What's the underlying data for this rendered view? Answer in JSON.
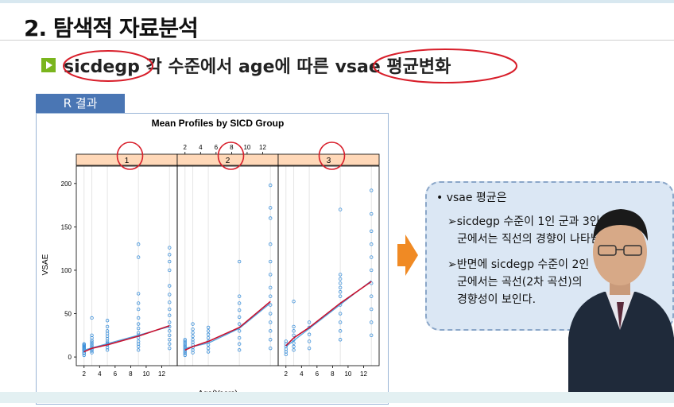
{
  "slide": {
    "title": "2. 탐색적 자료분석",
    "subtitle": "sicdegp 각 수준에서 age에 따른 vsae 평균변화",
    "tab_label": "R 결과"
  },
  "note": {
    "heading": "• vsae 평균은",
    "point1_line1": "➢sicdegp 수준이  1인 군과 3인",
    "point1_line2": "군에서는 직선의 경향이 나타남",
    "point2_line1": "➢반면에 sicdegp 수준이 2인",
    "point2_line2": "군에서는 곡선(2차 곡선)의",
    "point2_line3": "경향성이 보인다."
  },
  "chart_data": {
    "type": "scatter",
    "title": "Mean Profiles by SICD Group",
    "xlabel": "Age(Years)",
    "ylabel": "VSAE",
    "x_ticks": [
      2,
      4,
      6,
      8,
      10,
      12
    ],
    "y_ticks": [
      0,
      50,
      100,
      150,
      200
    ],
    "xlim": [
      1,
      14
    ],
    "ylim": [
      -10,
      220
    ],
    "panels": [
      {
        "name": "1",
        "points": {
          "2": [
            2,
            4,
            5,
            7,
            8,
            9,
            10,
            11,
            12,
            13,
            14,
            15
          ],
          "3": [
            5,
            7,
            9,
            11,
            13,
            15,
            17,
            19,
            22,
            25,
            45
          ],
          "5": [
            8,
            11,
            14,
            16,
            18,
            21,
            24,
            27,
            30,
            35,
            42
          ],
          "9": [
            8,
            12,
            15,
            18,
            22,
            25,
            28,
            33,
            38,
            45,
            55,
            62,
            73,
            115,
            130
          ],
          "13": [
            10,
            15,
            20,
            25,
            30,
            35,
            40,
            48,
            55,
            63,
            72,
            82,
            100,
            110,
            118,
            126
          ]
        },
        "mean_line": [
          [
            2,
            6
          ],
          [
            3,
            10
          ],
          [
            5,
            14
          ],
          [
            9,
            24
          ],
          [
            13,
            36
          ]
        ],
        "fit_line": [
          [
            2,
            8
          ],
          [
            13,
            35
          ]
        ]
      },
      {
        "name": "2",
        "points": {
          "2": [
            2,
            4,
            6,
            8,
            10,
            12,
            14,
            16,
            18,
            20
          ],
          "3": [
            5,
            8,
            11,
            14,
            17,
            20,
            24,
            28,
            32,
            38
          ],
          "5": [
            6,
            10,
            14,
            18,
            22,
            26,
            30,
            34
          ],
          "9": [
            8,
            15,
            22,
            30,
            38,
            46,
            54,
            62,
            70,
            110
          ],
          "13": [
            10,
            20,
            30,
            40,
            50,
            60,
            70,
            80,
            95,
            110,
            130,
            160,
            172,
            198
          ]
        },
        "mean_line": [
          [
            2,
            8
          ],
          [
            3,
            12
          ],
          [
            5,
            18
          ],
          [
            9,
            34
          ],
          [
            13,
            64
          ]
        ],
        "fit_line": [
          [
            2,
            10
          ],
          [
            5,
            16
          ],
          [
            9,
            33
          ],
          [
            13,
            62
          ]
        ]
      },
      {
        "name": "3",
        "points": {
          "2": [
            3,
            6,
            9,
            12,
            15,
            18
          ],
          "3": [
            8,
            12,
            16,
            20,
            25,
            30,
            35,
            64
          ],
          "5": [
            10,
            18,
            26,
            34,
            40
          ],
          "9": [
            20,
            30,
            40,
            50,
            60,
            70,
            75,
            80,
            85,
            90,
            95,
            170
          ],
          "13": [
            25,
            40,
            55,
            70,
            85,
            100,
            115,
            130,
            145,
            165,
            192
          ]
        },
        "mean_line": [
          [
            2,
            13
          ],
          [
            3,
            22
          ],
          [
            5,
            34
          ],
          [
            9,
            62
          ],
          [
            13,
            87
          ]
        ],
        "fit_line": [
          [
            2,
            12
          ],
          [
            13,
            88
          ]
        ]
      }
    ],
    "colors": {
      "points": "#3b8fd9",
      "mean_line": "#c8102e",
      "fit_line": "#4da3e0",
      "strip": "#ffd8b8"
    }
  }
}
